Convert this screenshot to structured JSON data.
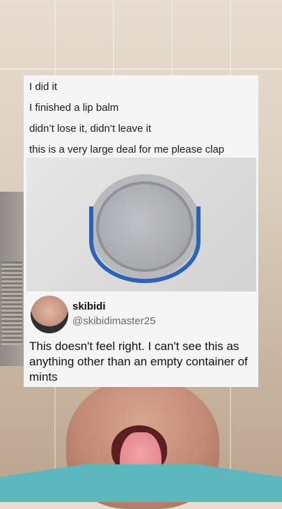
{
  "post": {
    "lines": [
      "I did it",
      "I finished a lip balm",
      "didn’t lose it, didn’t leave it",
      "this is a very large deal for me please clap"
    ]
  },
  "reply": {
    "display_name": "skibidi",
    "handle": "@skibidimaster25",
    "text": "This doesn't feel right. I can't see this as anything other than an empty container of mints"
  },
  "colors": {
    "card_background": "#f5f5f5",
    "tin_band": "#2f63b8",
    "shirt": "#5cb7be"
  }
}
